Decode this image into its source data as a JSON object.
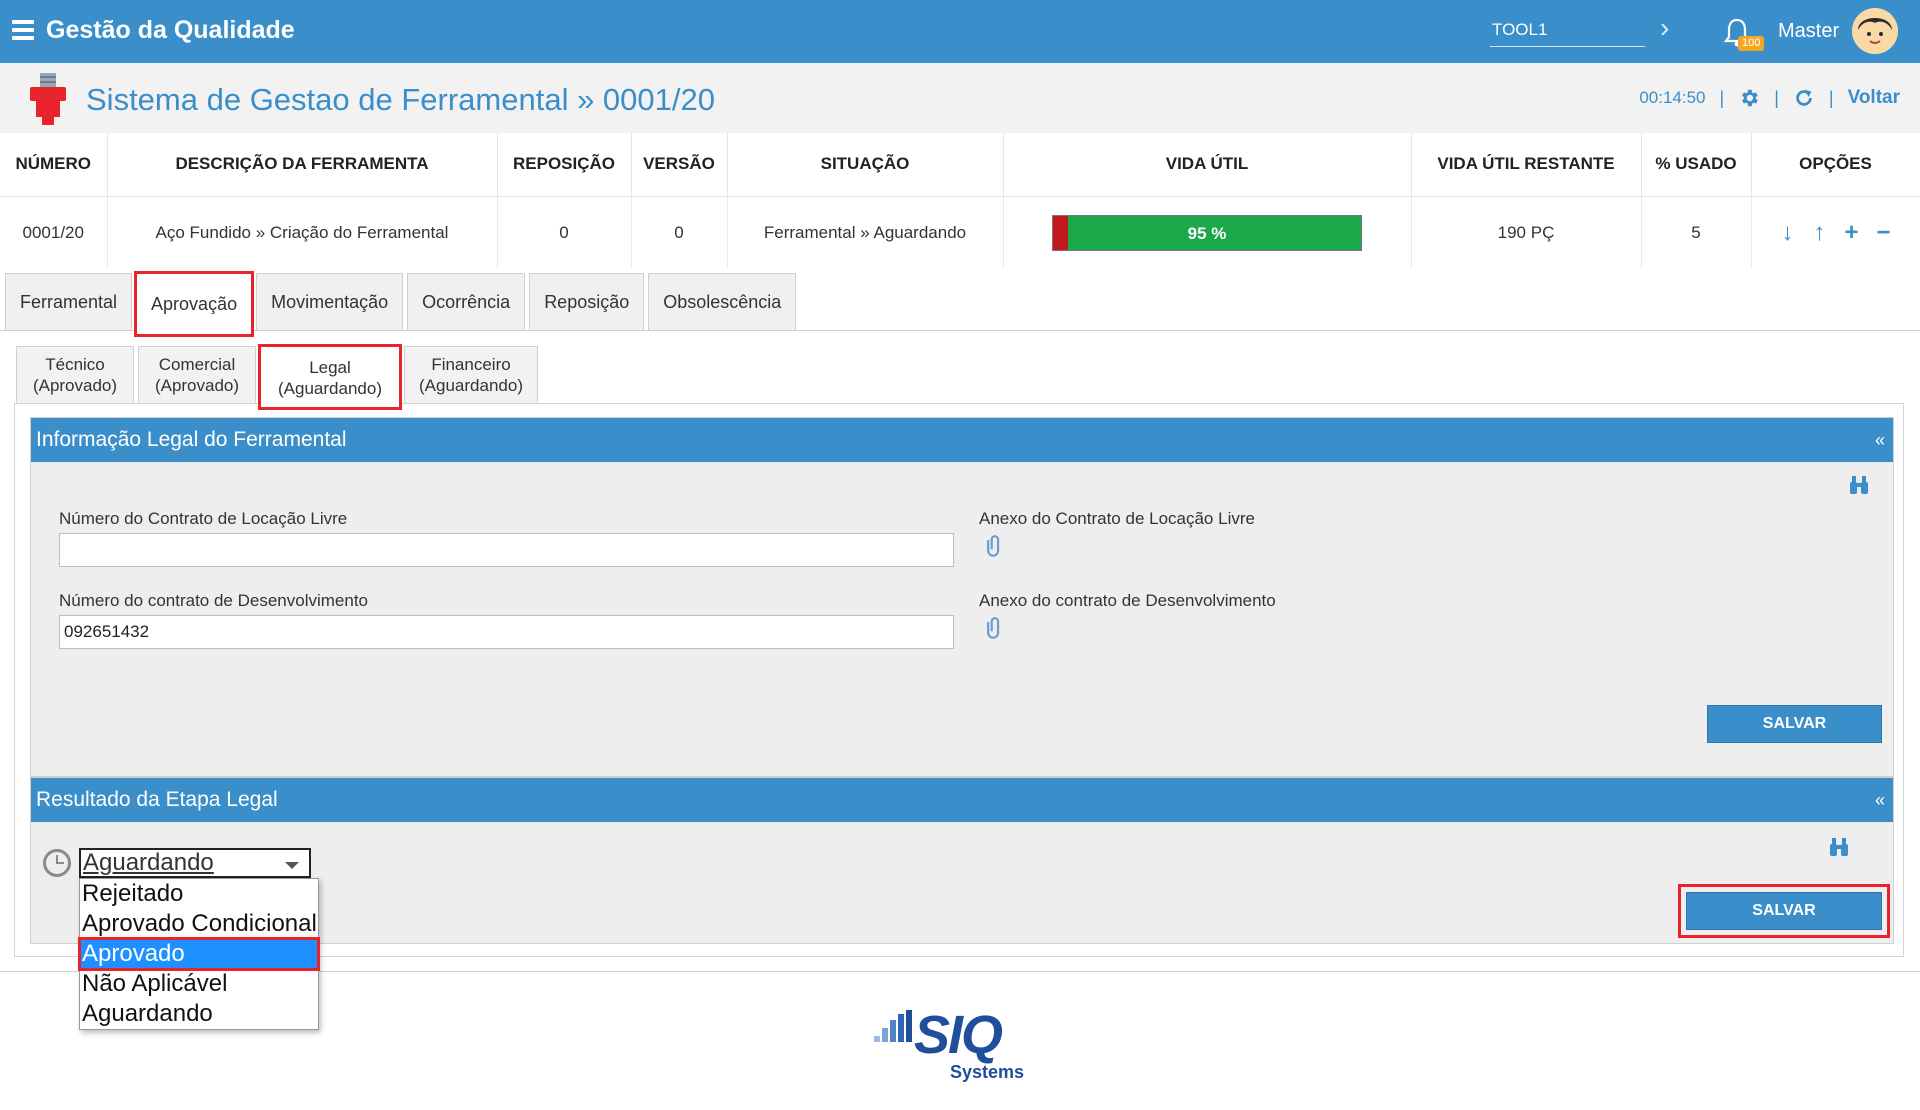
{
  "topbar": {
    "app_title": "Gestão da Qualidade",
    "tool_value": "TOOL1",
    "notification_count": "100",
    "user_name": "Master"
  },
  "header": {
    "title": "Sistema de Gestao de Ferramental » 0001/20",
    "time": "00:14:50",
    "back_label": "Voltar"
  },
  "info_table": {
    "headers": [
      "NÚMERO",
      "DESCRIÇÃO DA FERRAMENTA",
      "REPOSIÇÃO",
      "VERSÃO",
      "SITUAÇÃO",
      "VIDA ÚTIL",
      "VIDA ÚTIL RESTANTE",
      "% USADO",
      "OPÇÕES"
    ],
    "row": {
      "numero": "0001/20",
      "descricao": "Aço Fundido » Criação do Ferramental",
      "reposicao": "0",
      "versao": "0",
      "situacao": "Ferramental » Aguardando",
      "vida_util_label": "95 %",
      "vida_util_remaining_fraction": 0.95,
      "vida_restante": "190 PÇ",
      "usado": "5"
    }
  },
  "main_tabs": [
    "Ferramental",
    "Aprovação",
    "Movimentação",
    "Ocorrência",
    "Reposição",
    "Obsolescência"
  ],
  "sub_tabs": [
    {
      "line1": "Técnico",
      "line2": "(Aprovado)"
    },
    {
      "line1": "Comercial",
      "line2": "(Aprovado)"
    },
    {
      "line1": "Legal",
      "line2": "(Aguardando)"
    },
    {
      "line1": "Financeiro",
      "line2": "(Aguardando)"
    }
  ],
  "legal_info": {
    "title": "Informação Legal do Ferramental",
    "collapse": "«",
    "contrato_locacao_label": "Número do Contrato de Locação Livre",
    "contrato_locacao_value": "",
    "anexo_locacao_label": "Anexo do Contrato de Locação Livre",
    "contrato_desenv_label": "Número do contrato de Desenvolvimento",
    "contrato_desenv_value": "092651432",
    "anexo_desenv_label": "Anexo do contrato de Desenvolvimento",
    "save_label": "SALVAR"
  },
  "result": {
    "title": "Resultado da Etapa Legal",
    "collapse": "«",
    "select_value": "Aguardando",
    "options": [
      "Rejeitado",
      "Aprovado Condicional",
      "Aprovado",
      "Não Aplicável",
      "Aguardando"
    ],
    "save_label": "SALVAR"
  },
  "footer": {
    "logo_text": "SIQ",
    "logo_sub": "Systems"
  },
  "colors": {
    "primary": "#3a8ec9",
    "highlight": "#e8232b",
    "life_good": "#1aa84a",
    "life_used": "#c0181c"
  }
}
